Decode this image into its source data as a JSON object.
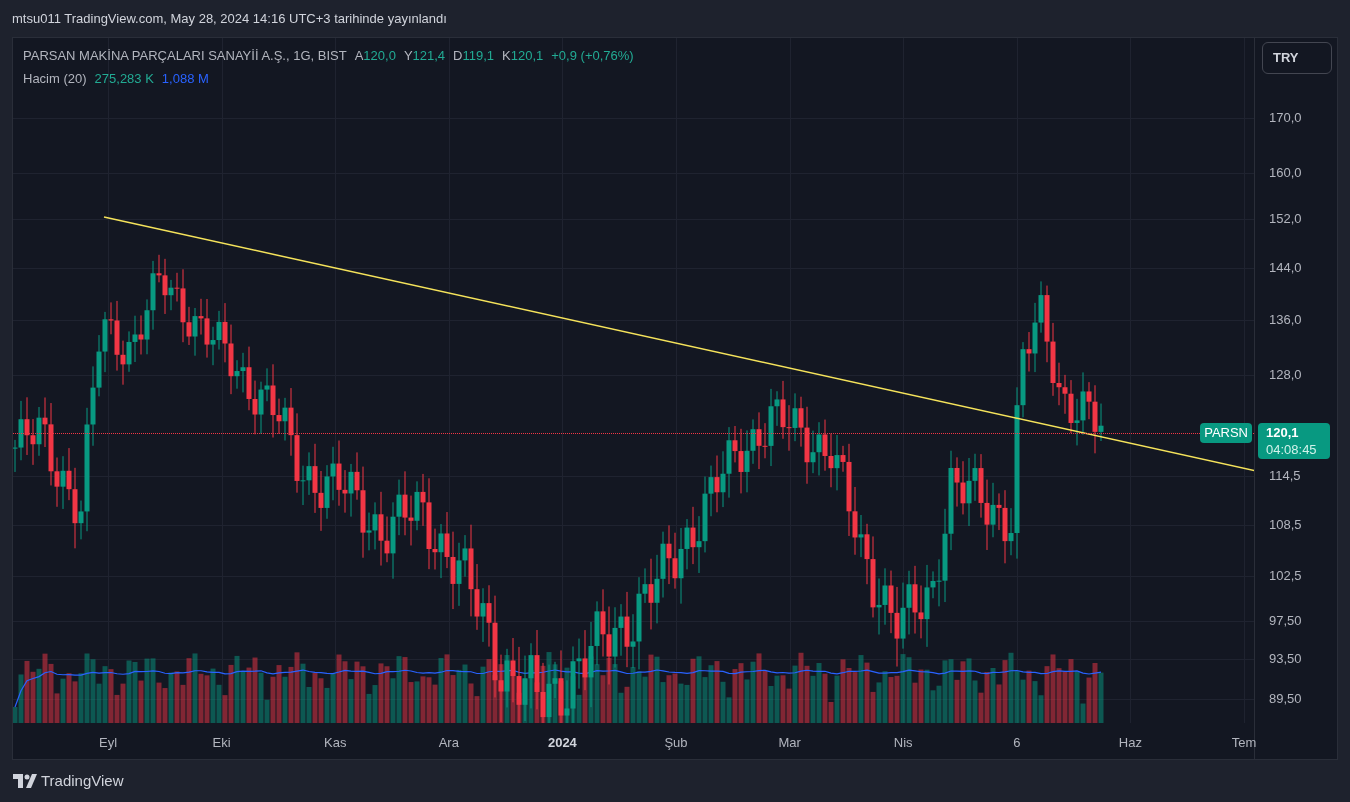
{
  "header": {
    "title": "mtsu011 TradingView.com, May 28, 2024 14:16 UTC+3 tarihinde yayınlandı"
  },
  "legend": {
    "symbol": "PARSAN MAKİNA PARÇALARI SANAYİİ A.Ş., 1G, BIST",
    "ohlc": [
      {
        "label": "A",
        "value": "120,0"
      },
      {
        "label": "Y",
        "value": "121,4"
      },
      {
        "label": "D",
        "value": "119,1"
      },
      {
        "label": "K",
        "value": "120,1"
      }
    ],
    "change": "+0,9 (+0,76%)",
    "volume_label": "Hacim (20)",
    "volume_values": [
      {
        "text": "275,283 K",
        "color": "#22ab94"
      },
      {
        "text": "1,088 M",
        "color": "#2962ff"
      }
    ]
  },
  "currency_button": "TRY",
  "price_axis": [
    "170,0",
    "160,0",
    "152,0",
    "144,0",
    "136,0",
    "128,0",
    "114,5",
    "108,5",
    "102,5",
    "97,50",
    "93,50",
    "89,50"
  ],
  "last_price": {
    "symbol": "PARSN",
    "price": "120,1",
    "countdown": "04:08:45"
  },
  "time_axis": [
    {
      "label": "Eyl",
      "bold": false
    },
    {
      "label": "Eki",
      "bold": false
    },
    {
      "label": "Kas",
      "bold": false
    },
    {
      "label": "Ara",
      "bold": false
    },
    {
      "label": "2024",
      "bold": true
    },
    {
      "label": "Şub",
      "bold": false
    },
    {
      "label": "Mar",
      "bold": false
    },
    {
      "label": "Nis",
      "bold": false
    },
    {
      "label": "6",
      "bold": false
    },
    {
      "label": "Haz",
      "bold": false
    },
    {
      "label": "Tem",
      "bold": false
    }
  ],
  "footer": {
    "brand": "TradingView"
  }
}
